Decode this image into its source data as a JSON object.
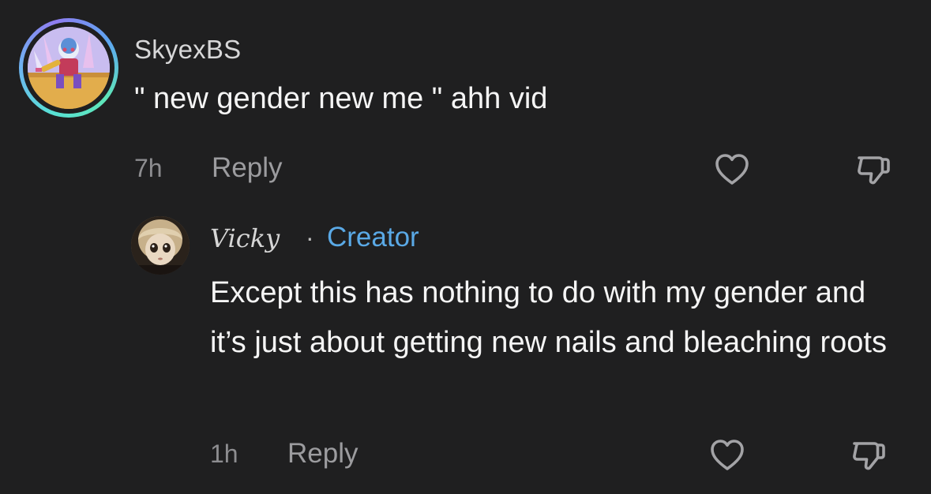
{
  "comment": {
    "username": "SkyexBS",
    "text": "\" new gender new me \" ahh vid",
    "time": "7h",
    "reply_label": "Reply",
    "like_icon": "heart-icon",
    "dislike_icon": "thumbs-down-icon",
    "ring_colors": [
      "#58e0d4",
      "#6fb3f2",
      "#8f7cf0"
    ]
  },
  "reply": {
    "username": "Vicky",
    "separator": "·",
    "badge": "Creator",
    "badge_color": "#5aa9e6",
    "text": "Except this has nothing to do with my gender and it’s just about getting new nails and bleaching roots",
    "time": "1h",
    "reply_label": "Reply",
    "like_icon": "heart-icon",
    "dislike_icon": "thumbs-down-icon"
  },
  "colors": {
    "background": "#1f1f20",
    "primary_text": "#f5f5f5",
    "secondary_text": "#9c9c9f"
  }
}
